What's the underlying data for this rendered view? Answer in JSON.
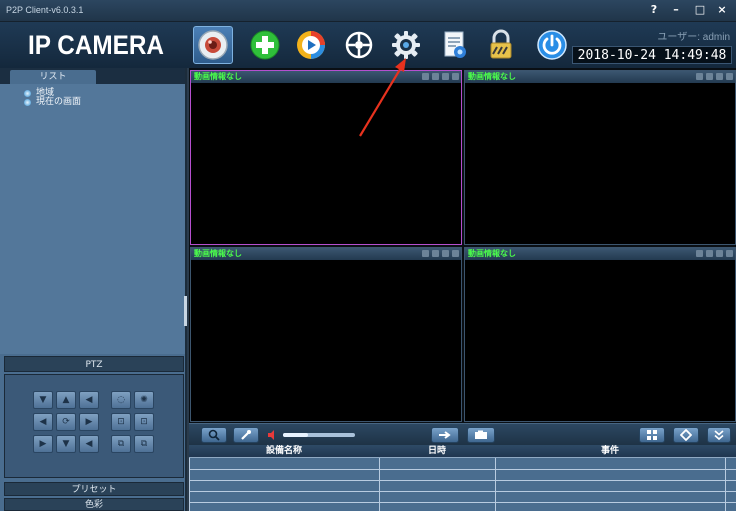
{
  "window": {
    "title": "P2P Client-v6.0.3.1",
    "controls": [
      "?",
      "–",
      "□",
      "×"
    ]
  },
  "header": {
    "logo": "IP CAMERA",
    "tools": [
      {
        "name": "live-view",
        "icon": "camera-icon",
        "active": true
      },
      {
        "name": "add-device",
        "icon": "add-icon",
        "active": false
      },
      {
        "name": "playback",
        "icon": "play-icon",
        "active": false
      },
      {
        "name": "ptz-control",
        "icon": "steering-wheel-icon",
        "active": false
      },
      {
        "name": "settings",
        "icon": "gear-icon",
        "active": false
      },
      {
        "name": "log",
        "icon": "document-icon",
        "active": false
      },
      {
        "name": "lock",
        "icon": "lock-icon",
        "active": false
      },
      {
        "name": "power",
        "icon": "power-icon",
        "active": false
      }
    ],
    "user_label": "ユーザー: admin",
    "datetime": "2018-10-24 14:49:48"
  },
  "sidebar": {
    "tab": "リスト",
    "tree": [
      "地域",
      "現在の画面"
    ],
    "ptz_label": "PTZ",
    "preset_label": "プリセット",
    "color_label": "色彩"
  },
  "video": {
    "cells": [
      {
        "title": "動画情報なし",
        "selected": true
      },
      {
        "title": "動画情報なし",
        "selected": false
      },
      {
        "title": "動画情報なし",
        "selected": false
      },
      {
        "title": "動画情報なし",
        "selected": false
      }
    ]
  },
  "bottombar": {
    "volume_level": 0.35
  },
  "events": {
    "columns": [
      "設備名称",
      "日時",
      "事件"
    ]
  },
  "colors": {
    "accent": "#b54fcf",
    "nosignal": "#4bff4b",
    "annotation": "#e8321e"
  }
}
